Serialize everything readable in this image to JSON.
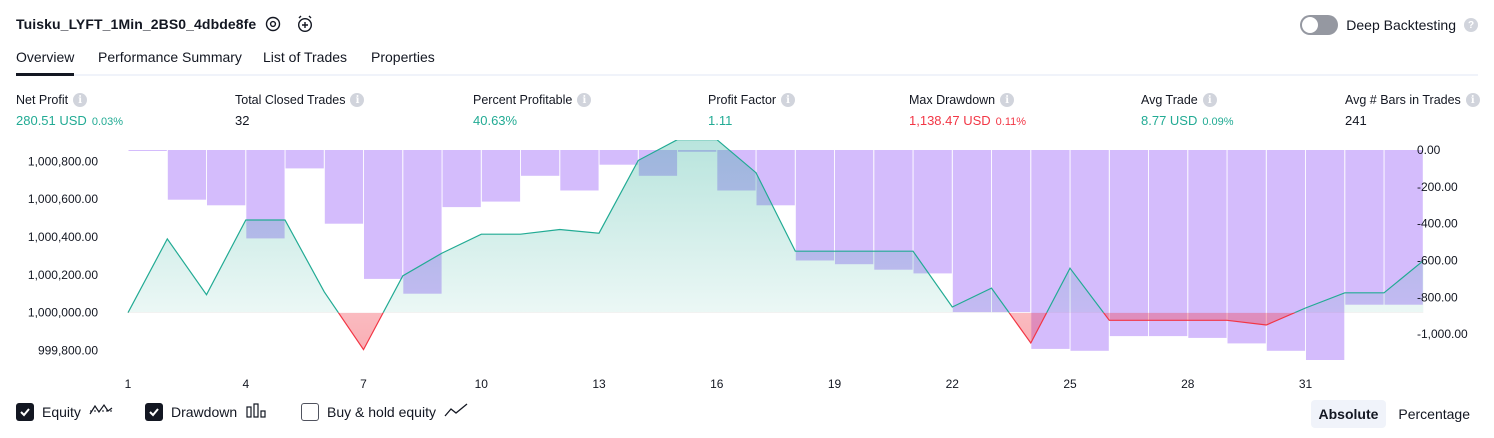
{
  "header": {
    "title": "Tuisku_LYFT_1Min_2BS0_4dbde8fe",
    "settings_icon": "settings-icon",
    "alert_icon": "add-alert-icon",
    "deep_backtesting_label": "Deep Backtesting",
    "deep_backtesting_enabled": false,
    "help_glyph": "?"
  },
  "tabs": [
    {
      "label": "Overview",
      "active": true
    },
    {
      "label": "Performance Summary",
      "active": false
    },
    {
      "label": "List of Trades",
      "active": false
    },
    {
      "label": "Properties",
      "active": false
    }
  ],
  "stats": [
    {
      "label": "Net Profit",
      "value": "280.51 USD",
      "pct": "0.03%",
      "color": "#22ab94"
    },
    {
      "label": "Total Closed Trades",
      "value": "32",
      "pct": "",
      "color": "#131722"
    },
    {
      "label": "Percent Profitable",
      "value": "40.63%",
      "pct": "",
      "color": "#22ab94"
    },
    {
      "label": "Profit Factor",
      "value": "1.11",
      "pct": "",
      "color": "#22ab94"
    },
    {
      "label": "Max Drawdown",
      "value": "1,138.47 USD",
      "pct": "0.11%",
      "color": "#f23645"
    },
    {
      "label": "Avg Trade",
      "value": "8.77 USD",
      "pct": "0.09%",
      "color": "#22ab94"
    },
    {
      "label": "Avg # Bars in Trades",
      "value": "241",
      "pct": "",
      "color": "#131722"
    }
  ],
  "info_glyph": "i",
  "chart_data": {
    "type": "line+bar",
    "x_ticks": [
      "1",
      "4",
      "7",
      "10",
      "13",
      "16",
      "19",
      "22",
      "25",
      "28",
      "31"
    ],
    "x": [
      1,
      2,
      3,
      4,
      5,
      6,
      7,
      8,
      9,
      10,
      11,
      12,
      13,
      14,
      15,
      16,
      17,
      18,
      19,
      20,
      21,
      22,
      23,
      24,
      25,
      26,
      27,
      28,
      29,
      30,
      31,
      32,
      33
    ],
    "equity_axis": {
      "side": "left",
      "ylim": [
        999750,
        1000860
      ],
      "ticks": [
        "1,000,800.00",
        "1,000,600.00",
        "1,000,400.00",
        "1,000,200.00",
        "1,000,000.00",
        "999,800.00"
      ],
      "tick_values": [
        1000800,
        1000600,
        1000400,
        1000200,
        1000000,
        999800
      ]
    },
    "drawdown_axis": {
      "side": "right",
      "ylim": [
        -1140,
        0
      ],
      "ticks": [
        "0.00",
        "-200.00",
        "-400.00",
        "-600.00",
        "-800.00",
        "-1,000.00"
      ],
      "tick_values": [
        0,
        -200,
        -400,
        -600,
        -800,
        -1000
      ]
    },
    "equity": [
      1000000,
      1000390,
      1000095,
      1000490,
      1000490,
      1000110,
      999805,
      1000195,
      1000315,
      1000415,
      1000415,
      1000440,
      1000420,
      1000805,
      1000915,
      1000915,
      1000740,
      1000325,
      1000325,
      1000325,
      1000325,
      1000030,
      1000130,
      999840,
      1000235,
      999960,
      999960,
      999960,
      999960,
      999935,
      1000025,
      1000105,
      1000105,
      1000275
    ],
    "drawdown": [
      -5,
      -270,
      -300,
      -480,
      -100,
      -400,
      -700,
      -780,
      -310,
      -280,
      -140,
      -220,
      -80,
      -140,
      -10,
      -220,
      -300,
      -600,
      -620,
      -650,
      -670,
      -880,
      -880,
      -1080,
      -1090,
      -1010,
      -1010,
      -1020,
      -1050,
      -1090,
      -1140,
      -840,
      -840
    ],
    "equity_series_name": "Equity",
    "drawdown_series_name": "Drawdown",
    "colors": {
      "equity_up": "#22ab94",
      "equity_down": "#f23645",
      "equity_line_peak": "#2962ff",
      "drawdown_bar": "#c6a6fb"
    }
  },
  "legend": {
    "items": [
      {
        "label": "Equity",
        "checked": true,
        "icon": "equity-line-icon"
      },
      {
        "label": "Drawdown",
        "checked": true,
        "icon": "drawdown-bars-icon"
      },
      {
        "label": "Buy & hold equity",
        "checked": false,
        "icon": "buy-hold-line-icon"
      }
    ],
    "modes": [
      {
        "label": "Absolute",
        "active": true
      },
      {
        "label": "Percentage",
        "active": false
      }
    ]
  }
}
